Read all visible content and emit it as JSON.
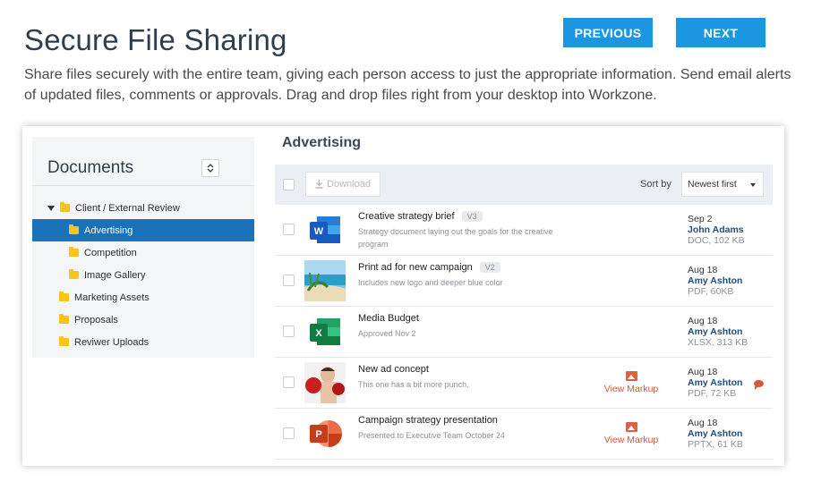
{
  "header": {
    "title": "Secure File Sharing",
    "description": "Share files securely with the entire team, giving each person access to just the appropriate information. Send email alerts of updated files, comments or approvals. Drag and drop files right from your desktop into Workzone.",
    "previous_label": "PREVIOUS",
    "next_label": "NEXT"
  },
  "sidebar": {
    "title": "Documents",
    "collapse_glyph": "⌃⌄",
    "items": [
      {
        "label": "Client / External Review",
        "expanded": true
      },
      {
        "label": "Advertising",
        "selected": true
      },
      {
        "label": "Competition"
      },
      {
        "label": "Image Gallery"
      },
      {
        "label": "Marketing Assets"
      },
      {
        "label": "Proposals"
      },
      {
        "label": "Reviwer Uploads"
      }
    ]
  },
  "main": {
    "title": "Advertising",
    "download_label": "Download",
    "sort_label": "Sort by",
    "sort_value": "Newest first"
  },
  "files": [
    {
      "name": "Creative strategy brief",
      "version": "V3",
      "description": "Strategy document laying out the goals for the creative program",
      "date": "Sep 2",
      "owner": "John Adams",
      "size": "DOC, 102 KB",
      "icon": "word-icon",
      "markup": ""
    },
    {
      "name": "Print ad for new campaign",
      "version": "V2",
      "description": "Includes new logo and deeper blue color",
      "date": "Aug 18",
      "owner": "Amy Ashton",
      "size": "PDF, 60KB",
      "icon": "beach-photo-thumbnail",
      "markup": ""
    },
    {
      "name": "Media Budget",
      "version": "",
      "description": "Approved Nov 2",
      "date": "Aug 18",
      "owner": "Amy Ashton",
      "size": "XLSX, 313 KB",
      "icon": "excel-icon",
      "markup": ""
    },
    {
      "name": "New ad concept",
      "version": "",
      "description": "This one has a bit more punch.",
      "date": "Aug 18",
      "owner": "Amy Ashton",
      "size": "PDF, 72 KB",
      "icon": "boxer-photo-thumbnail",
      "markup": "View Markup"
    },
    {
      "name": "Campaign strategy presentation",
      "version": "",
      "description": "Presented to Executive Team October 24",
      "date": "Aug 18",
      "owner": "Amy Ashton",
      "size": "PPTX, 61 KB",
      "icon": "powerpoint-icon",
      "markup": "View Markup"
    }
  ],
  "colors": {
    "accent": "#1a97e0",
    "selected": "#1a73ba",
    "folder": "#f5c518",
    "markup": "#d2573a"
  }
}
